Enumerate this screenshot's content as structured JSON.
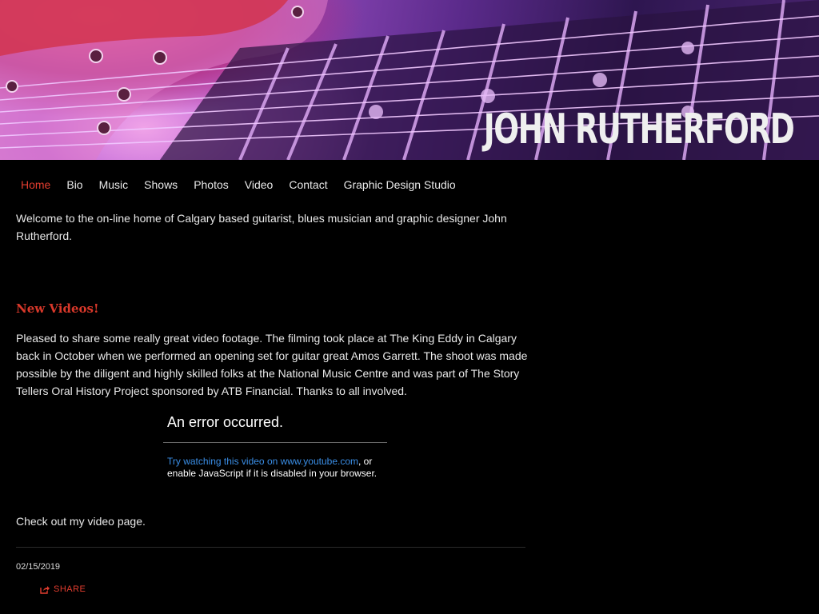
{
  "header": {
    "site_title": "JOHN RUTHERFORD"
  },
  "nav": {
    "items": [
      {
        "label": "Home",
        "active": true
      },
      {
        "label": "Bio"
      },
      {
        "label": "Music"
      },
      {
        "label": "Shows"
      },
      {
        "label": "Photos"
      },
      {
        "label": "Video"
      },
      {
        "label": "Contact"
      },
      {
        "label": "Graphic Design Studio"
      }
    ]
  },
  "main": {
    "intro": "Welcome to the on-line home of Calgary based guitarist, blues musician and graphic designer John Rutherford.",
    "post": {
      "title": "New Videos!",
      "body": "Pleased to share some really great video footage. The filming took place at The King Eddy in Calgary back in October when we performed an opening set for guitar great Amos Garrett. The shoot was made possible by the diligent and highly skilled folks at the National Music Centre and was part of The Story Tellers Oral History Project sponsored by ATB Financial. Thanks to all involved.",
      "video_error": {
        "title": "An error occurred.",
        "link_text": "Try watching this video on www.youtube.com",
        "rest_text": ", or enable JavaScript if it is disabled in your browser."
      },
      "checkout": "Check out my video page.",
      "date": "02/15/2019",
      "share_label": "SHARE"
    }
  },
  "colors": {
    "accent": "#e23d2f",
    "link": "#3a8ee6",
    "background": "#000000"
  }
}
